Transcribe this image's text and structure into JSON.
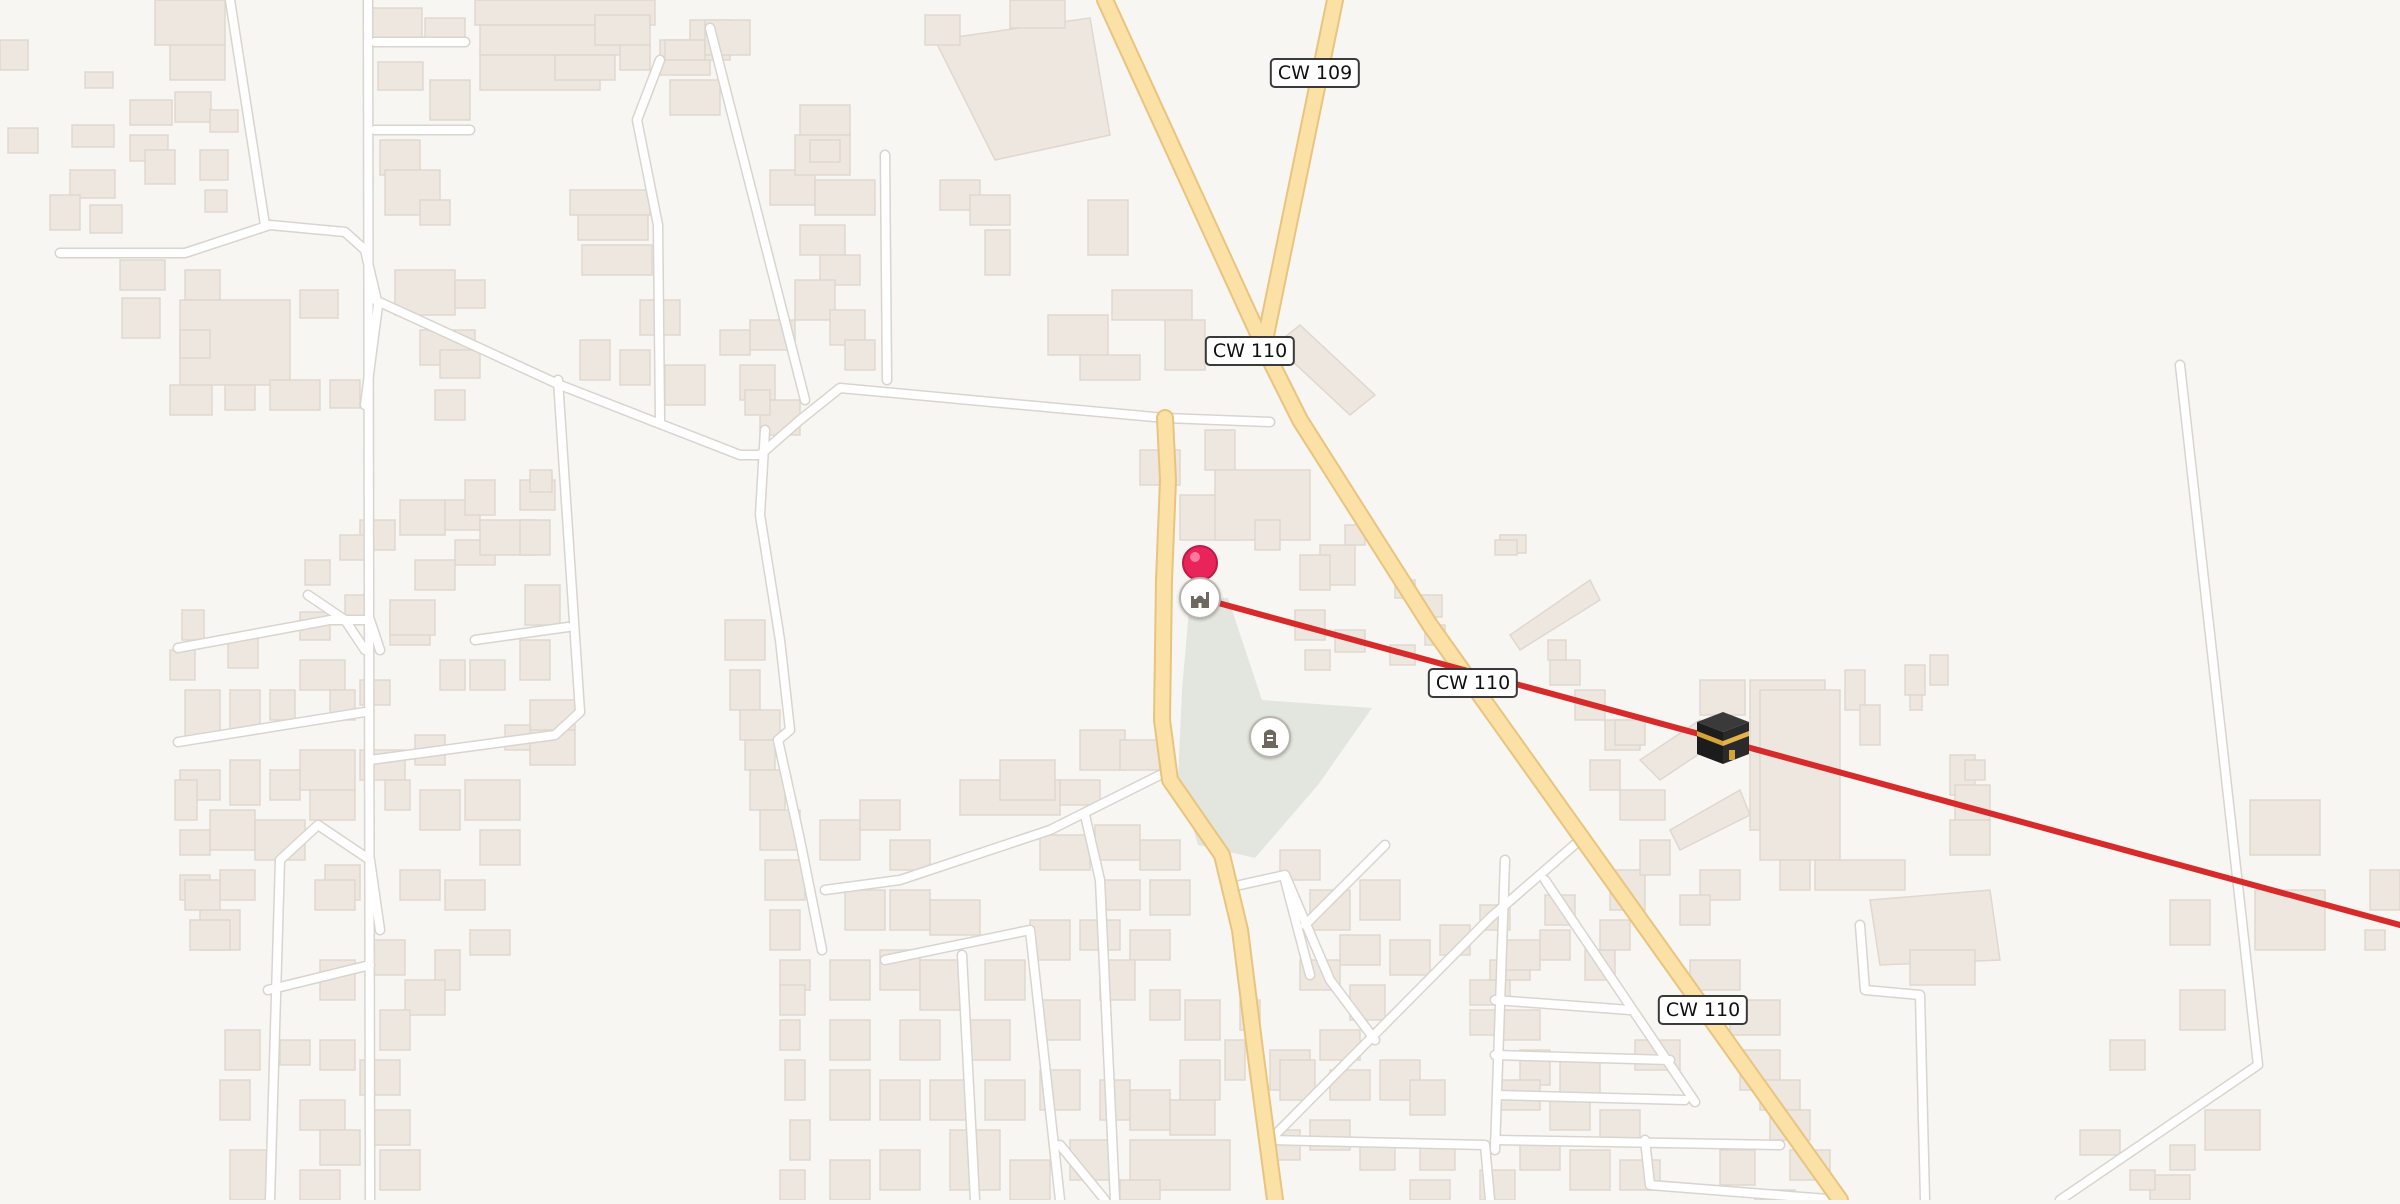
{
  "map": {
    "route_color": "#d72a2a",
    "road_labels": [
      {
        "id": "cw109-north",
        "text": "CW 109"
      },
      {
        "id": "cw110-north",
        "text": "CW 110"
      },
      {
        "id": "cw110-middle",
        "text": "CW 110"
      },
      {
        "id": "cw110-south",
        "text": "CW 110"
      }
    ],
    "pois": [
      {
        "id": "mosque-poi",
        "icon": "mosque-icon"
      },
      {
        "id": "cemetery-poi",
        "icon": "grave-icon"
      },
      {
        "id": "kaaba-destination",
        "icon": "kaaba-icon"
      },
      {
        "id": "current-location-pin",
        "icon": "location-pin-icon",
        "color": "#e8245a"
      }
    ]
  }
}
